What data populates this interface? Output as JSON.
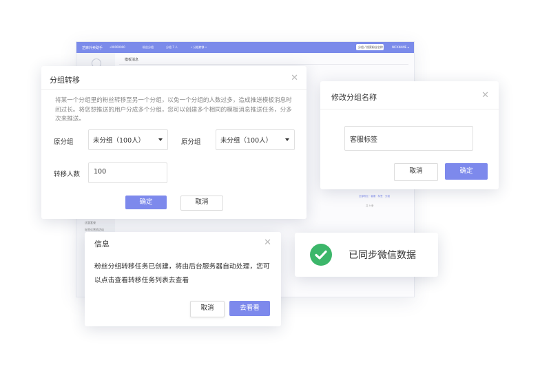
{
  "colors": {
    "accent": "#7d89ec",
    "topbar": "#7b8bea",
    "success": "#3cb66a"
  },
  "background_app": {
    "brand": "芝麻外卖助手",
    "nav": [
      "•00000000",
      "粉丝分组",
      "分组 7 人",
      "• 分组转移 •"
    ],
    "search": "分组 / 搜索粉丝名称",
    "user": "NICKNAME ▾",
    "page_title": "模板消息",
    "sidebar_items": [
      "优惠套餐",
      "标签化营销活动"
    ],
    "footer_links": "全部粉丝 · 客服 · 标签 · 分组",
    "pager_count": "共 9 条"
  },
  "transfer_dialog": {
    "title": "分组转移",
    "description": "将某一个分组里的粉丝转移至另一个分组，以免一个分组的人数过多，造成推送模板消息时间过长。将您想推送的用户分成多个分组，您可以创建多个相同的模板消息推送任务，分多次来推送。",
    "source_label": "原分组",
    "source_value": "未分组（100人）",
    "target_label": "原分组",
    "target_value": "未分组（100人）",
    "count_label": "转移人数",
    "count_value": "100",
    "confirm": "确定",
    "cancel": "取消"
  },
  "rename_dialog": {
    "title": "修改分组名称",
    "input_value": "客服标签",
    "cancel": "取消",
    "confirm": "确定"
  },
  "info_dialog": {
    "title": "信息",
    "message": "粉丝分组转移任务已创建，将由后台服务器自动处理，您可以点击查看转移任务列表去查看",
    "cancel": "取消",
    "view": "去看看"
  },
  "toast": {
    "icon": "check-circle-icon",
    "message": "已同步微信数据"
  }
}
